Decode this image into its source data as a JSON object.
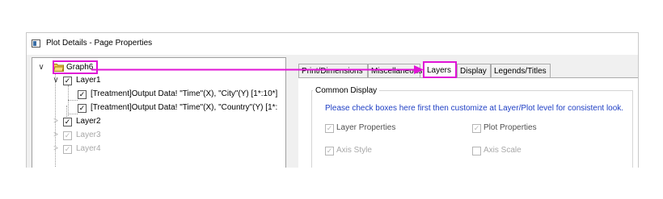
{
  "window": {
    "title": "Plot Details - Page Properties"
  },
  "tree": {
    "root": {
      "label": "Graph6",
      "expand": "∨",
      "icon": "folder-open-icon"
    },
    "layer1": {
      "label": "Layer1",
      "expand": "∨",
      "checked": "✓"
    },
    "plot1": {
      "label": "[Treatment]Output Data! \"Time\"(X), \"City\"(Y) [1*:10*]",
      "checked": "✓"
    },
    "plot2": {
      "label": "[Treatment]Output Data! \"Time\"(X), \"Country\"(Y) [1*:",
      "checked": "✓"
    },
    "layer2": {
      "label": "Layer2",
      "expand": ">",
      "checked": "✓"
    },
    "layer3": {
      "label": "Layer3",
      "expand": ">",
      "checked": "✓"
    },
    "layer4": {
      "label": "Layer4",
      "expand": ">",
      "checked": "✓"
    }
  },
  "tabs": [
    {
      "label": "Print/Dimensions"
    },
    {
      "label": "Miscellaneous"
    },
    {
      "label": "Layers",
      "active": true
    },
    {
      "label": "Display"
    },
    {
      "label": "Legends/Titles"
    }
  ],
  "common_display": {
    "group_label": "Common Display",
    "info_text": "Please check boxes here first then customize at Layer/Plot level for consistent look.",
    "options": [
      {
        "label": "Layer Properties",
        "checked": "✓",
        "enabled": true
      },
      {
        "label": "Plot Properties",
        "checked": "✓",
        "enabled": true
      },
      {
        "label": "Axis Style",
        "checked": "✓",
        "enabled": false
      },
      {
        "label": "Axis Scale",
        "checked": "",
        "enabled": false
      }
    ]
  },
  "colors": {
    "highlight": "#e014d6",
    "info_text": "#1f3fc4",
    "folder": "#f2c94c"
  }
}
